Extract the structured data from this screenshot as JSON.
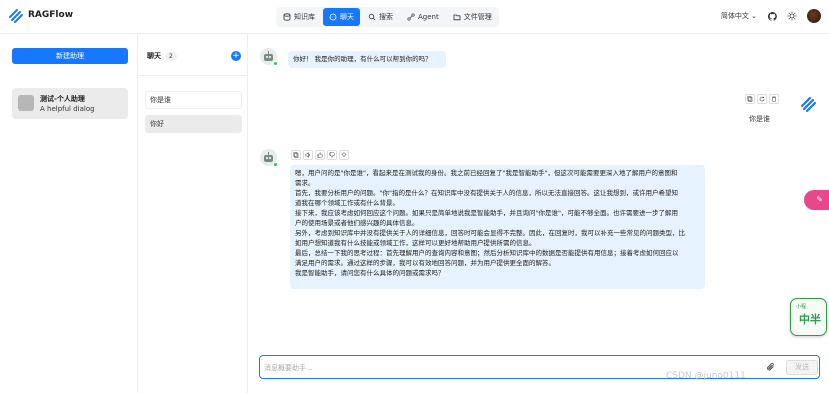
{
  "app": {
    "title": "RAGFlow"
  },
  "nav": {
    "items": [
      {
        "label": "知识库",
        "icon": "database-icon",
        "active": false
      },
      {
        "label": "聊天",
        "icon": "chat-icon",
        "active": true
      },
      {
        "label": "搜索",
        "icon": "search-icon",
        "active": false
      },
      {
        "label": "Agent",
        "icon": "agent-icon",
        "active": false
      },
      {
        "label": "文件管理",
        "icon": "folder-icon",
        "active": false
      }
    ]
  },
  "topright": {
    "language": "简体中文",
    "language_caret": "⌄"
  },
  "left": {
    "new_button": "新建助理",
    "assistant": {
      "name": "测试-个人助理",
      "description": "A helpful dialog"
    }
  },
  "conversations": {
    "title": "聊天",
    "count": "2",
    "items": [
      {
        "label": "你是谁",
        "selected": false
      },
      {
        "label": "你好",
        "selected": true
      }
    ]
  },
  "chat": {
    "greeting": "你好！ 我是你的助理，有什么可以帮到你的吗？",
    "user_message": "你是谁",
    "answer_lines": [
      "嗯，用户问的是\"你是谁\"，看起来是在测试我的身份。我之前已经回复了\"我是智能助手\"，但这次可能需要更深入地了解用户的意图和",
      "需求。",
      "首先，我要分析用户的问题。\"你\"指的是什么？在知识库中没有提供关于人的信息，所以无法直接回答。这让我想到，或许用户希望知",
      "道我在哪个领域工作或有什么背景。",
      "接下来，我应该考虑如何回应这个问题。如果只是简单地说我是智能助手，并且询问\"你是谁\"，可能不够全面。也许需要进一步了解用",
      "户的使用场景或者他们感兴趣的具体信息。",
      "另外，考虑到知识库中并没有提供关于人的详细信息，回答时可能会显得不完整。因此，在回复时，我可以补充一些常见的问题类型，比",
      "如用户想知道我有什么技能或领域工作，这样可以更好地帮助用户提供所需的信息。",
      "最后，总结一下我的思考过程：首先理解用户的查询内容和意图；然后分析知识库中的数据是否能提供有用信息；接着考虑如何回应以",
      "满足用户的需求。通过这样的步骤，我可以有效地回答问题，并为用户提供更全面的解答。",
      "我是智能助手，请问您有什么具体的问题或需求吗？"
    ],
    "input_placeholder": "消息概要助手...",
    "send_label": "发送"
  },
  "widgets": {
    "pink_tab": "✎",
    "zh_widget_small": "小程",
    "zh_widget_main": "中半"
  },
  "watermark": "CSDN @juno0111"
}
